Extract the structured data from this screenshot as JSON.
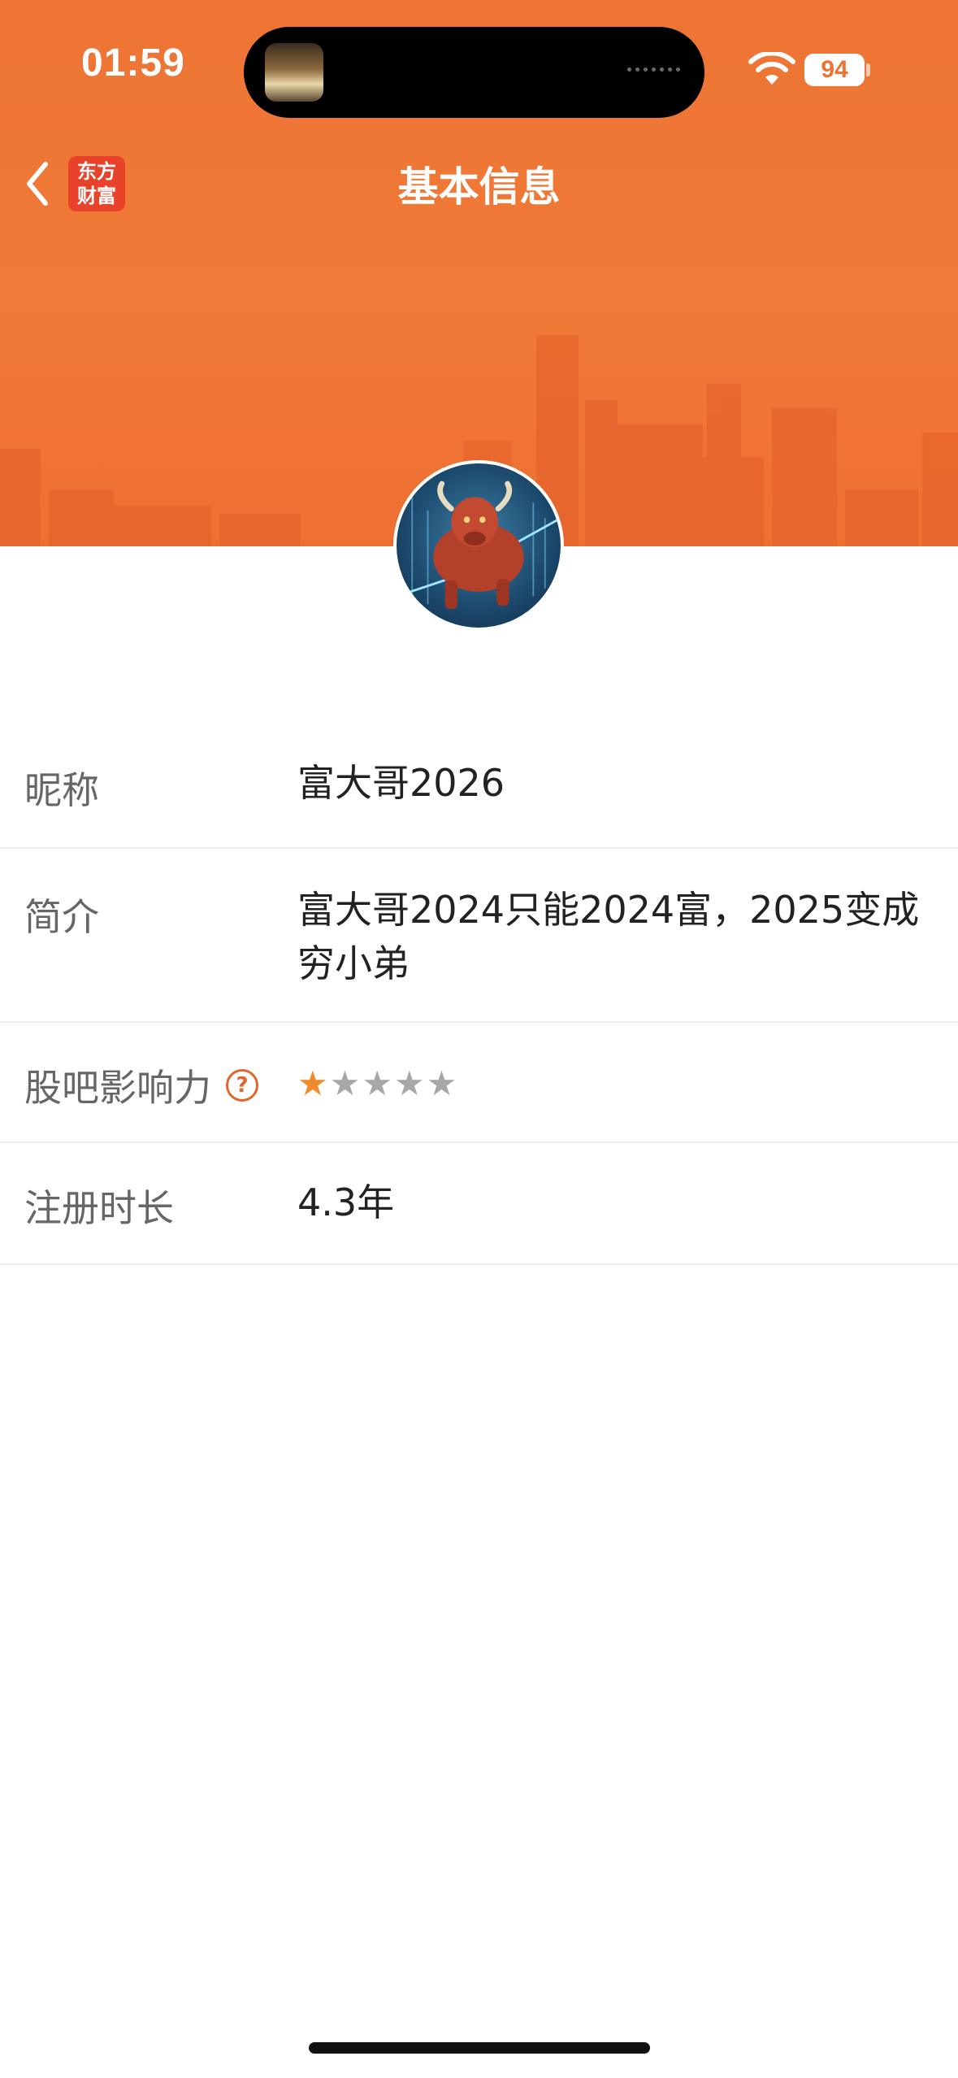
{
  "status_bar": {
    "time": "01:59",
    "battery": "94"
  },
  "nav": {
    "title": "基本信息",
    "app_logo_line1": "东方",
    "app_logo_line2": "财富"
  },
  "profile": {
    "rows": [
      {
        "label": "昵称",
        "value": "富大哥2026"
      },
      {
        "label": "简介",
        "value": "富大哥2024只能2024富，2025变成穷小弟"
      },
      {
        "label": "股吧影响力",
        "help": "?",
        "rating": 1,
        "rating_max": 5
      },
      {
        "label": "注册时长",
        "value": "4.3年"
      }
    ]
  },
  "icons": {
    "back": "chevron-left-icon",
    "wifi": "wifi-icon",
    "help": "question-circle-icon",
    "star": "star-icon"
  },
  "colors": {
    "brand_orange": "#ee7434",
    "star_active": "#f08a2a",
    "star_inactive": "#a7a7a7",
    "logo_red": "#e8422a"
  }
}
